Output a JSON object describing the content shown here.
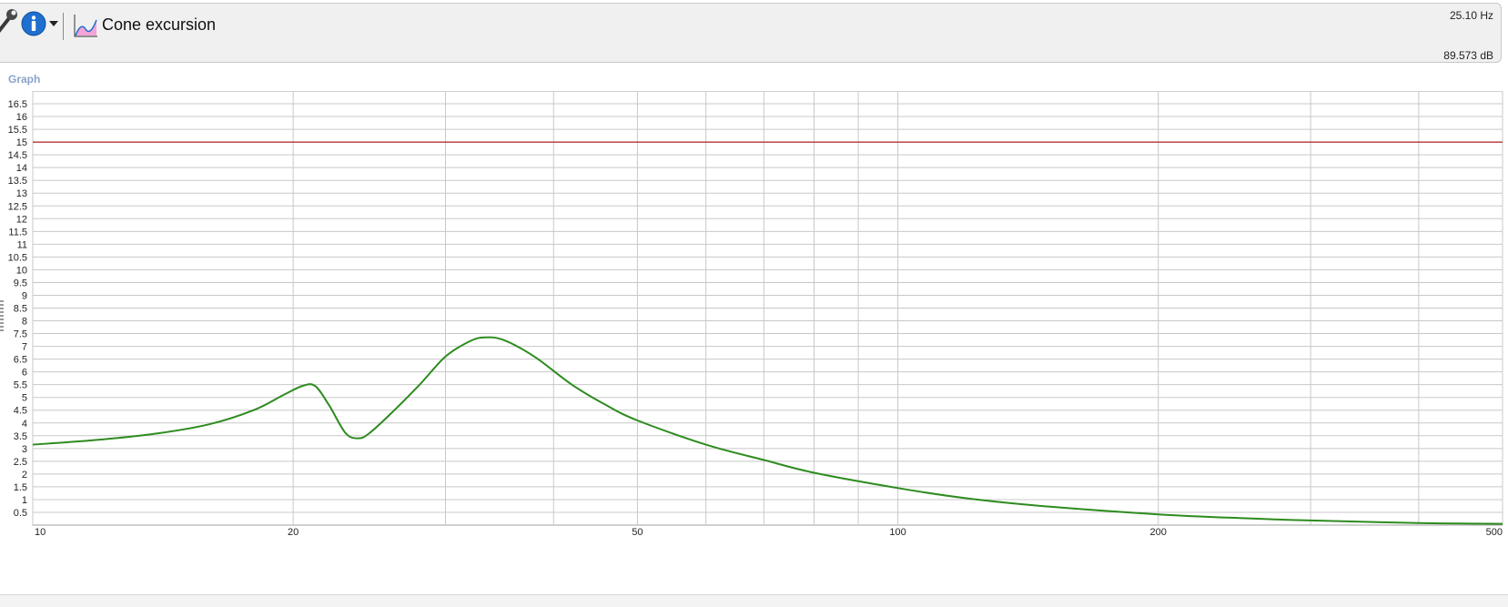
{
  "toolbar": {
    "view_title": "Cone excursion",
    "frequency_readout": "25.10 Hz",
    "level_readout": "89.573 dB",
    "icons": [
      "wrench-icon",
      "info-icon",
      "dropdown-arrow-icon",
      "graph-icon"
    ]
  },
  "section_label": "Graph",
  "colors": {
    "curve": "#2e8b1f",
    "limit_line": "#b22222",
    "grid": "#c8c8c8"
  },
  "chart_data": {
    "type": "line",
    "title": "",
    "xlabel": "",
    "ylabel": "",
    "x_scale": "log",
    "xlim": [
      10,
      500
    ],
    "ylim": [
      0,
      17
    ],
    "x_tick_labels": [
      "10",
      "20",
      "50",
      "100",
      "200",
      "500"
    ],
    "x_ticks": [
      10,
      20,
      50,
      100,
      200,
      500
    ],
    "x_minor_gridlines": [
      30,
      40,
      60,
      70,
      80,
      90,
      300,
      400
    ],
    "y_ticks": [
      0.5,
      1,
      1.5,
      2,
      2.5,
      3,
      3.5,
      4,
      4.5,
      5,
      5.5,
      6,
      6.5,
      7,
      7.5,
      8,
      8.5,
      9,
      9.5,
      10,
      10.5,
      11,
      11.5,
      12,
      12.5,
      13,
      13.5,
      14,
      14.5,
      15,
      15.5,
      16,
      16.5
    ],
    "y_tick_labels": [
      "0.5",
      "1",
      "1.5",
      "2",
      "2.5",
      "3",
      "3.5",
      "4",
      "4.5",
      "5",
      "5.5",
      "6",
      "6.5",
      "7",
      "7.5",
      "8",
      "8.5",
      "9",
      "9.5",
      "10",
      "10.5",
      "11",
      "11.5",
      "12",
      "12.5",
      "13",
      "13.5",
      "14",
      "14.5",
      "15",
      "15.5",
      "16",
      "16.5"
    ],
    "grid": true,
    "limit_line": 15,
    "series": [
      {
        "x": [
          10,
          12,
          14,
          16,
          18,
          19.5,
          20.5,
          21.2,
          22,
          23,
          23.8,
          24.5,
          26,
          28,
          30,
          32,
          33.3,
          35,
          38,
          42,
          46,
          50,
          60,
          70,
          80,
          100,
          120,
          150,
          200,
          250,
          300,
          400,
          500
        ],
        "y": [
          3.15,
          3.35,
          3.6,
          3.95,
          4.5,
          5.1,
          5.45,
          5.45,
          4.7,
          3.6,
          3.4,
          3.6,
          4.4,
          5.5,
          6.6,
          7.2,
          7.35,
          7.25,
          6.6,
          5.5,
          4.7,
          4.1,
          3.15,
          2.55,
          2.05,
          1.45,
          1.05,
          0.72,
          0.42,
          0.27,
          0.18,
          0.08,
          0.05
        ]
      }
    ]
  }
}
